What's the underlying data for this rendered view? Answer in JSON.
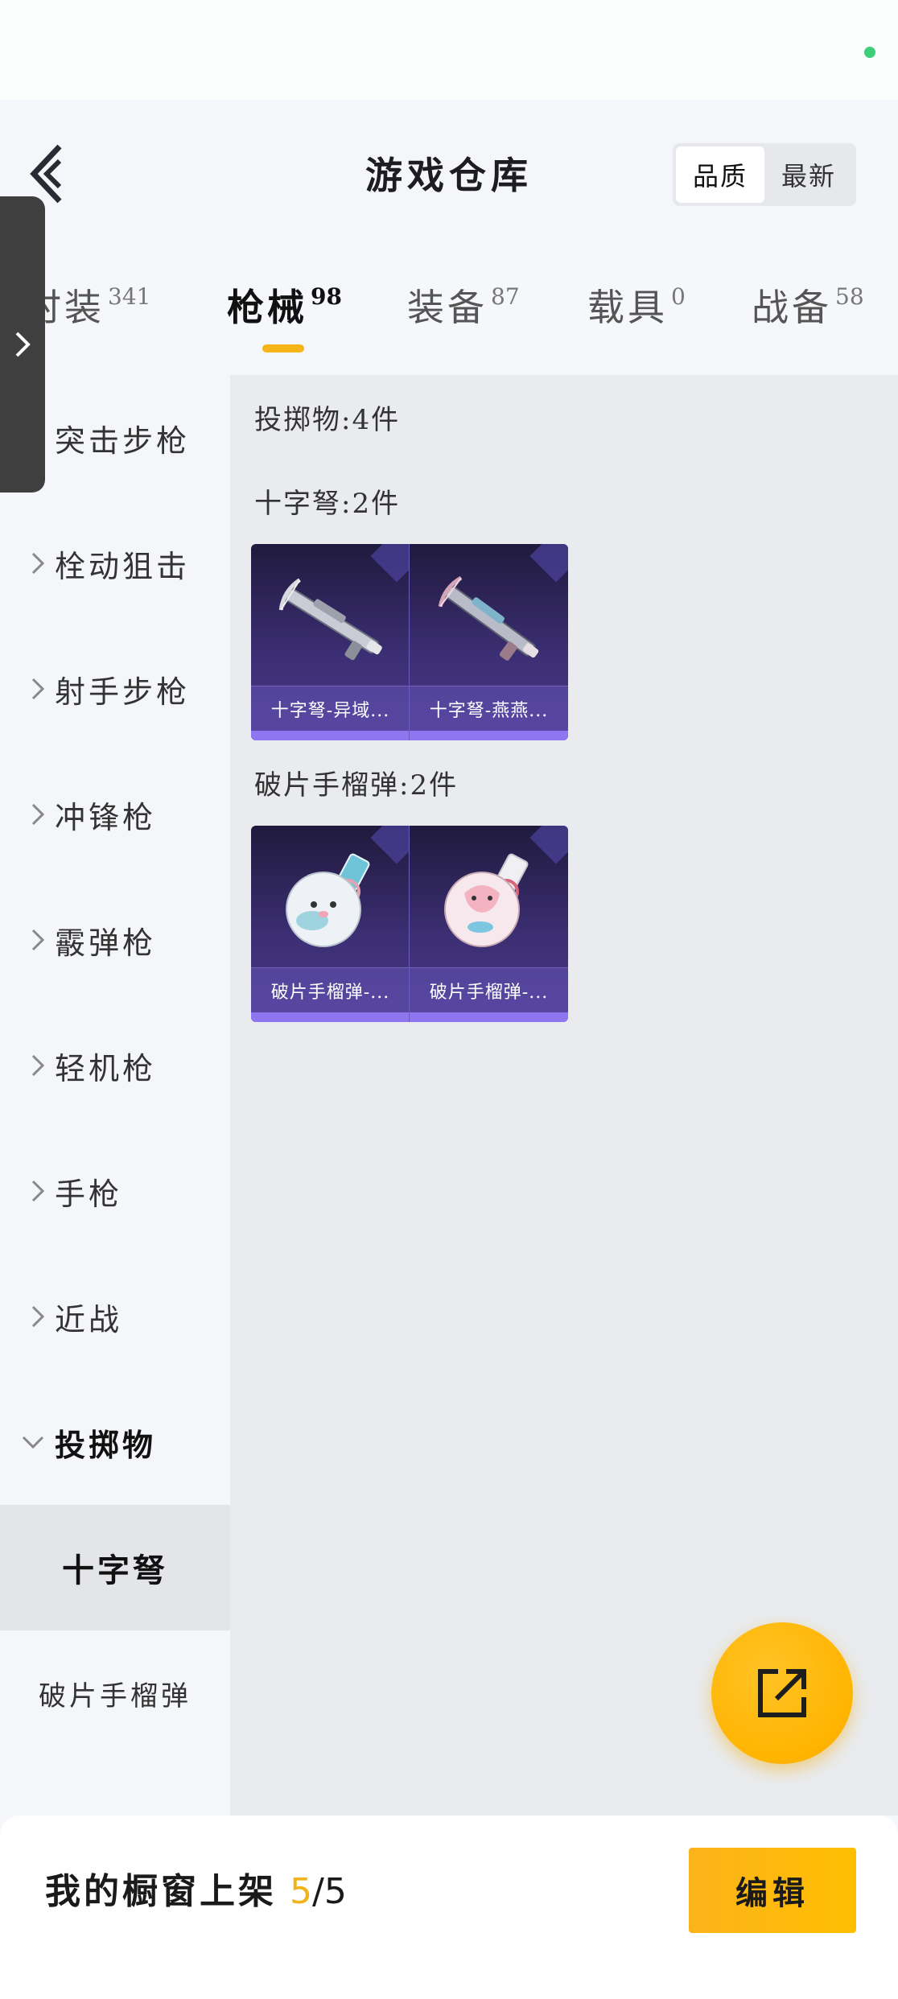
{
  "header": {
    "title": "游戏仓库",
    "sort": {
      "options": [
        "品质",
        "最新"
      ],
      "selected": "品质"
    }
  },
  "tabs": [
    {
      "label": "时装",
      "count": "341",
      "active": false
    },
    {
      "label": "枪械",
      "count": "98",
      "active": true
    },
    {
      "label": "装备",
      "count": "87",
      "active": false
    },
    {
      "label": "载具",
      "count": "0",
      "active": false
    },
    {
      "label": "战备",
      "count": "58",
      "active": false
    }
  ],
  "sidebar": {
    "items": [
      {
        "label": "突击步枪",
        "icon": "chevron-right-icon"
      },
      {
        "label": "栓动狙击",
        "icon": "chevron-right-icon"
      },
      {
        "label": "射手步枪",
        "icon": "chevron-right-icon"
      },
      {
        "label": "冲锋枪",
        "icon": "chevron-right-icon"
      },
      {
        "label": "霰弹枪",
        "icon": "chevron-right-icon"
      },
      {
        "label": "轻机枪",
        "icon": "chevron-right-icon"
      },
      {
        "label": "手枪",
        "icon": "chevron-right-icon"
      },
      {
        "label": "近战",
        "icon": "chevron-right-icon"
      },
      {
        "label": "投掷物",
        "icon": "chevron-down-icon",
        "expanded": true
      }
    ],
    "subitems": [
      {
        "label": "十字弩",
        "active": true
      },
      {
        "label": "破片手榴弹",
        "active": false
      }
    ]
  },
  "content": {
    "summary": "投掷物:4件",
    "groups": [
      {
        "title": "十字弩:2件",
        "items": [
          {
            "name": "十字弩-异域...",
            "icon": "crossbow-icon"
          },
          {
            "name": "十字弩-燕燕...",
            "icon": "crossbow-icon"
          }
        ]
      },
      {
        "title": "破片手榴弹:2件",
        "items": [
          {
            "name": "破片手榴弹-...",
            "icon": "grenade-icon"
          },
          {
            "name": "破片手榴弹-...",
            "icon": "grenade-icon"
          }
        ]
      }
    ]
  },
  "fab": {
    "icon": "share-icon"
  },
  "bottom": {
    "shelf_label": "我的橱窗上架",
    "shelf_current": "5",
    "shelf_sep": "/",
    "shelf_max": "5",
    "edit_label": "编辑"
  },
  "colors": {
    "accent": "#f5b417",
    "card_bar": "#8d76f0",
    "status_dot": "#3ecf7a"
  }
}
